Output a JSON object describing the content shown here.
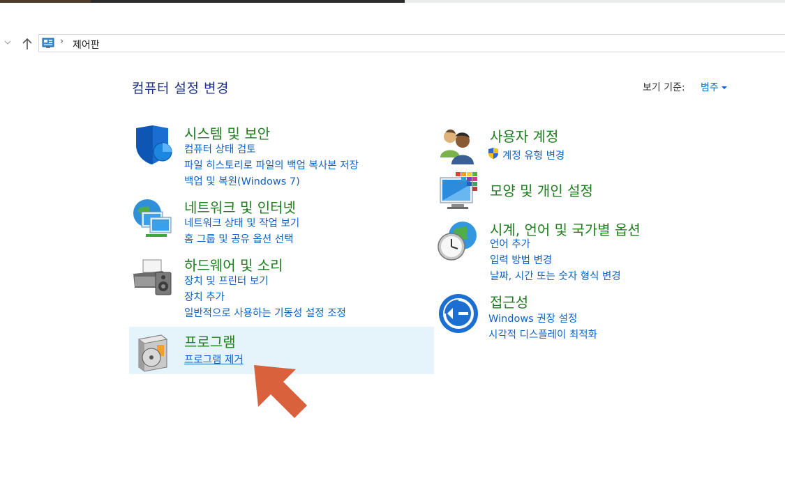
{
  "address": {
    "crumb": "제어판"
  },
  "header": {
    "title": "컴퓨터 설정 변경",
    "view_by_label": "보기 기준:",
    "view_by_value": "범주"
  },
  "categories": {
    "system": {
      "title": "시스템 및 보안",
      "links": [
        "컴퓨터 상태 검토",
        "파일 히스토리로 파일의 백업 복사본 저장",
        "백업 및 복원(Windows 7)"
      ],
      "icon": "shield-icon"
    },
    "network": {
      "title": "네트워크 및 인터넷",
      "links": [
        "네트워크 상태 및 작업 보기",
        "홈 그룹 및 공유 옵션 선택"
      ],
      "icon": "network-globe-icon"
    },
    "hardware": {
      "title": "하드웨어 및 소리",
      "links": [
        "장치 및 프린터 보기",
        "장치 추가",
        "일반적으로 사용하는 기동성 설정 조정"
      ],
      "icon": "printer-speaker-icon"
    },
    "programs": {
      "title": "프로그램",
      "links": [
        "프로그램 제거"
      ],
      "icon": "programs-box-icon"
    },
    "users": {
      "title": "사용자 계정",
      "links": [
        "계정 유형 변경"
      ],
      "icon": "users-icon"
    },
    "appearance": {
      "title": "모양 및 개인 설정",
      "links": [],
      "icon": "appearance-monitor-icon"
    },
    "clock": {
      "title": "시계, 언어 및 국가별 옵션",
      "links": [
        "언어 추가",
        "입력 방법 변경",
        "날짜, 시간 또는 숫자 형식 변경"
      ],
      "icon": "clock-globe-icon"
    },
    "access": {
      "title": "접근성",
      "links": [
        "Windows 권장 설정",
        "시각적 디스플레이 최적화"
      ],
      "icon": "ease-of-access-icon"
    }
  },
  "colors": {
    "title_green": "#1e7d1e",
    "link_blue": "#0f62c4",
    "highlight": "#e5f3fb",
    "annotation_arrow": "#d9623c"
  }
}
